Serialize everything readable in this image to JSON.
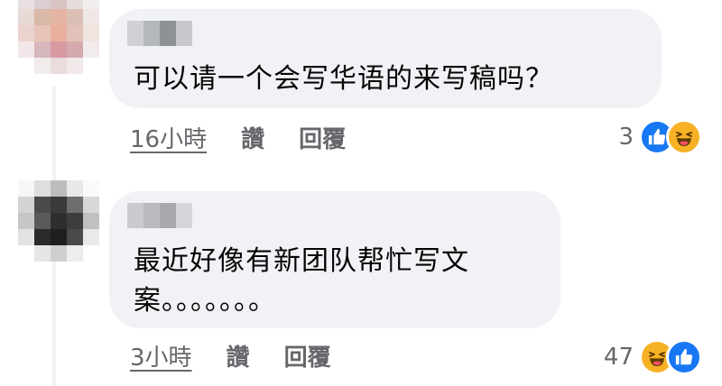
{
  "comments": [
    {
      "text": "可以请一个会写华语的来写稿吗？",
      "timestamp": "16小時",
      "like_label": "讚",
      "reply_label": "回覆",
      "reaction_count": "3",
      "reaction_icons": [
        "like-icon",
        "haha-icon"
      ]
    },
    {
      "text": "最近好像有新团队帮忙写文案。。。。。。。",
      "timestamp": "3小時",
      "like_label": "讚",
      "reply_label": "回覆",
      "reaction_count": "47",
      "reaction_icons": [
        "haha-icon",
        "like-icon"
      ]
    }
  ],
  "colors": {
    "bubble": "#f0f2f5",
    "text": "#050505",
    "meta": "#65676b",
    "like": "#1877f2",
    "haha": "#f7b125"
  }
}
